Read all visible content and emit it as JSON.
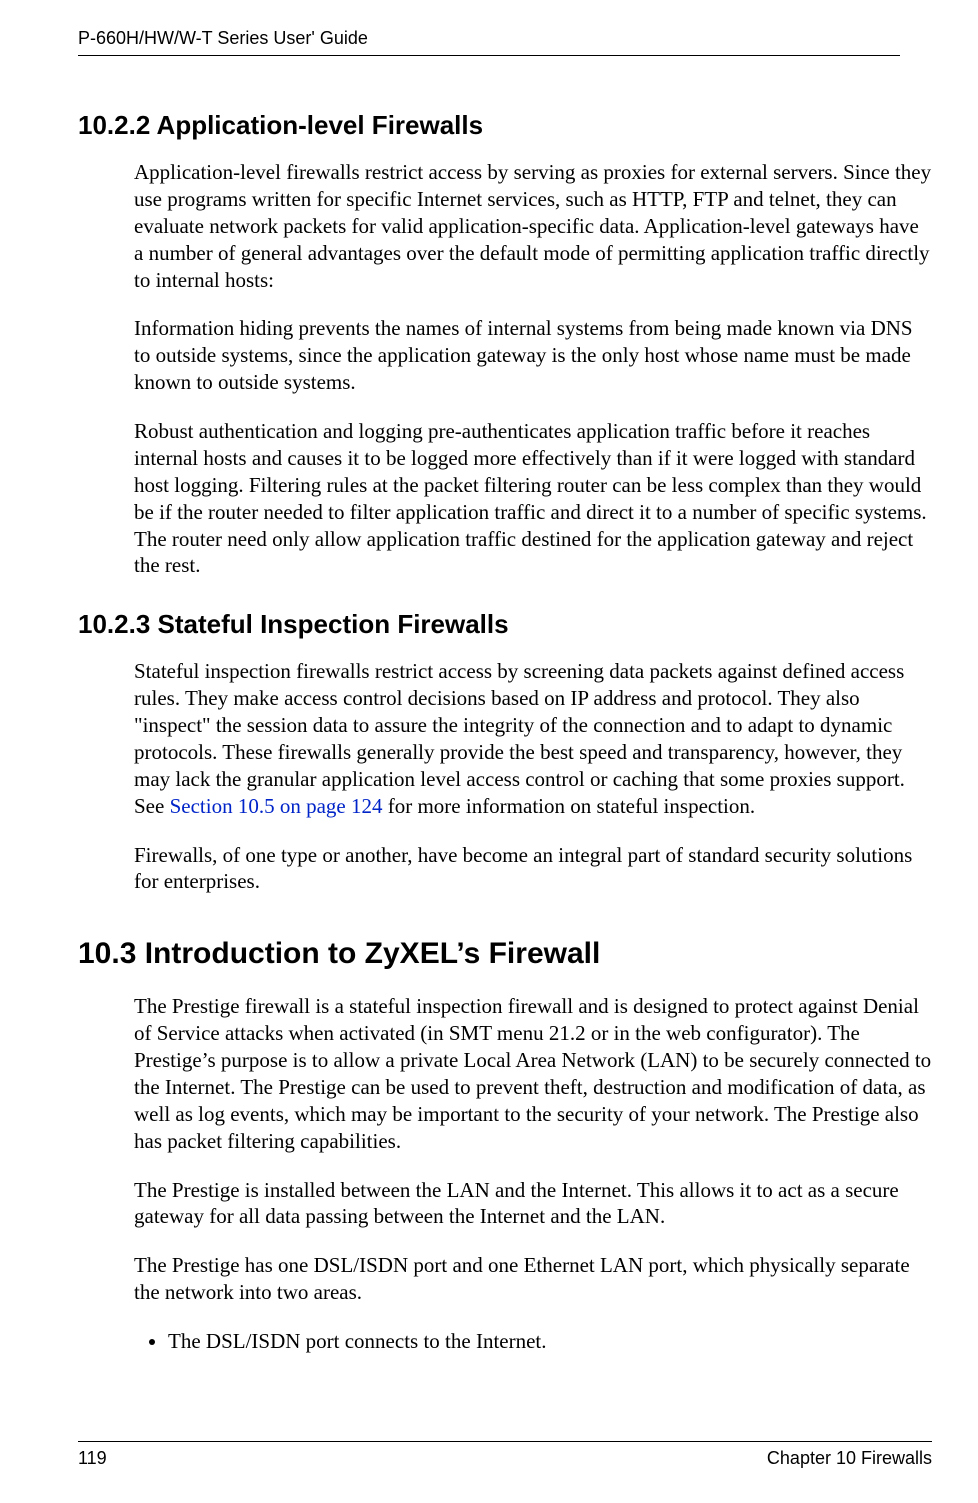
{
  "header": {
    "running_title": "P-660H/HW/W-T Series User' Guide"
  },
  "sections": {
    "s10_2_2": {
      "heading": "10.2.2  Application-level Firewalls",
      "p1": "Application-level firewalls restrict access by serving as proxies for external servers. Since they use programs written for specific Internet services, such as HTTP, FTP and telnet, they can evaluate network packets for valid application-specific data. Application-level gateways have a number of general advantages over the default mode of permitting application traffic directly to internal hosts:",
      "p2": "Information hiding prevents the names of internal systems from being made known via DNS to outside systems, since the application gateway is the only host whose name must be made known to outside systems.",
      "p3": "Robust authentication and logging pre-authenticates application traffic before it reaches internal hosts and causes it to be logged more effectively than if it were logged with standard host logging. Filtering rules at the packet filtering router can be less complex than they would be if the router needed to filter application traffic and direct it to a number of specific systems. The router need only allow application traffic destined for the application gateway and reject the rest."
    },
    "s10_2_3": {
      "heading": "10.2.3   Stateful Inspection Firewalls",
      "p1_pre": "Stateful inspection firewalls restrict access by screening data packets against defined access rules. They make access control decisions based on IP address and protocol. They also \"inspect\" the session data to assure the integrity of the connection and to adapt to dynamic protocols. These firewalls generally provide the best speed and transparency, however, they may lack the granular application level access control or caching that some proxies support. See ",
      "p1_xref": "Section 10.5 on page 124",
      "p1_post": " for more information on stateful inspection.",
      "p2": "Firewalls, of one type or another, have become an integral part of standard security solutions for enterprises."
    },
    "s10_3": {
      "heading": "10.3  Introduction to ZyXEL’s Firewall",
      "p1": "The Prestige firewall is a stateful inspection firewall and is designed to protect against Denial of Service attacks when activated (in SMT menu 21.2 or in the web configurator). The Prestige’s purpose is to allow a private Local Area Network (LAN) to be securely connected to the Internet. The Prestige can be used to prevent theft, destruction and modification of data, as well as log events, which may be important to the security of your network. The Prestige also has packet filtering capabilities.",
      "p2": "The Prestige is installed between the LAN and the Internet. This allows it to act as a secure gateway for all data passing between the Internet and the LAN.",
      "p3": "The Prestige has one DSL/ISDN port and one Ethernet LAN port, which physically separate the network into two areas.",
      "bullet1": "The DSL/ISDN port connects to the Internet."
    }
  },
  "footer": {
    "page_number": "119",
    "chapter_label": "Chapter 10 Firewalls"
  }
}
